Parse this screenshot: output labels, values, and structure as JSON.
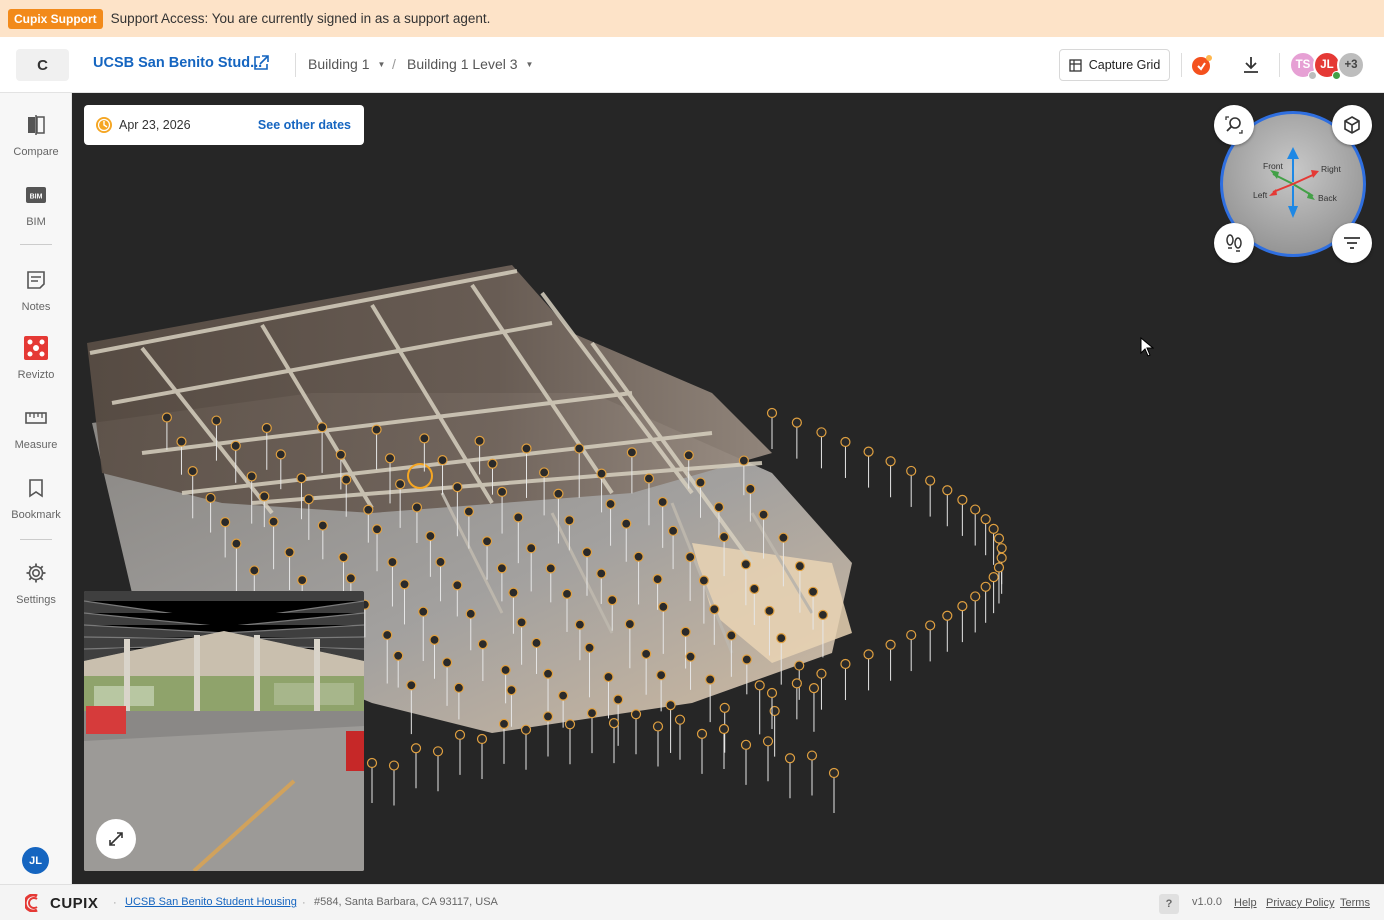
{
  "banner": {
    "badge": "Cupix Support",
    "message": "Support Access: You are currently signed in as a support agent."
  },
  "header": {
    "logo_letter": "C",
    "project_name": "UCSB San Benito Stud...",
    "building": "Building 1",
    "level": "Building 1 Level 3",
    "capture_grid_label": "Capture Grid",
    "avatars": [
      {
        "initials": "TS",
        "color": "#e6a0d4"
      },
      {
        "initials": "JL",
        "color": "#e53935"
      },
      {
        "initials": "+3",
        "color": "#bdbdbd"
      }
    ]
  },
  "sidebar": {
    "items": [
      {
        "label": "Compare",
        "icon": "compare-icon"
      },
      {
        "label": "BIM",
        "icon": "bim-icon"
      },
      {
        "label": "Notes",
        "icon": "notes-icon"
      },
      {
        "label": "Revizto",
        "icon": "revizto-icon"
      },
      {
        "label": "Measure",
        "icon": "ruler-icon"
      },
      {
        "label": "Bookmark",
        "icon": "bookmark-icon"
      },
      {
        "label": "Settings",
        "icon": "gear-icon"
      }
    ],
    "user_initials": "JL"
  },
  "viewer": {
    "capture_date": "Apr 23, 2026",
    "see_other_dates": "See other dates",
    "navigator": {
      "front": "Front",
      "right": "Right",
      "left": "Left",
      "back": "Back"
    }
  },
  "footer": {
    "brand": "CUPIX",
    "project_link": "UCSB San Benito Student Housing",
    "address": "#584, Santa Barbara, CA 93117, USA",
    "help_symbol": "?",
    "version": "v1.0.0",
    "links": {
      "help": "Help",
      "privacy": "Privacy Policy",
      "terms": "Terms"
    }
  },
  "colors": {
    "accent": "#1565c0",
    "banner_bg": "#fde3c8",
    "badge": "#f28a1a",
    "viewer_bg": "#262626"
  }
}
